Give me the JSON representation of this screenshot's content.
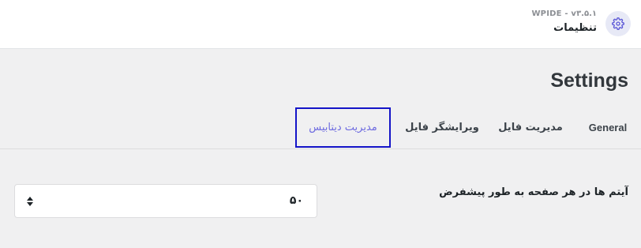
{
  "header": {
    "app_version": "WPIDE - v۳.۵.۱",
    "app_title": "تنظیمات",
    "icon": "gear-icon",
    "accent_color": "#6d6ae0"
  },
  "page": {
    "title": "Settings"
  },
  "tabs": [
    {
      "label": "General",
      "active": false
    },
    {
      "label": "مدیریت فایل",
      "active": false
    },
    {
      "label": "ویرایشگر فایل",
      "active": false
    },
    {
      "label": "مدیریت دیتابیس",
      "active": true
    }
  ],
  "settings": {
    "items_per_page_label": "آیتم ها در هر صفحه به طور پیشفرض",
    "items_per_page_value": "۵۰"
  }
}
